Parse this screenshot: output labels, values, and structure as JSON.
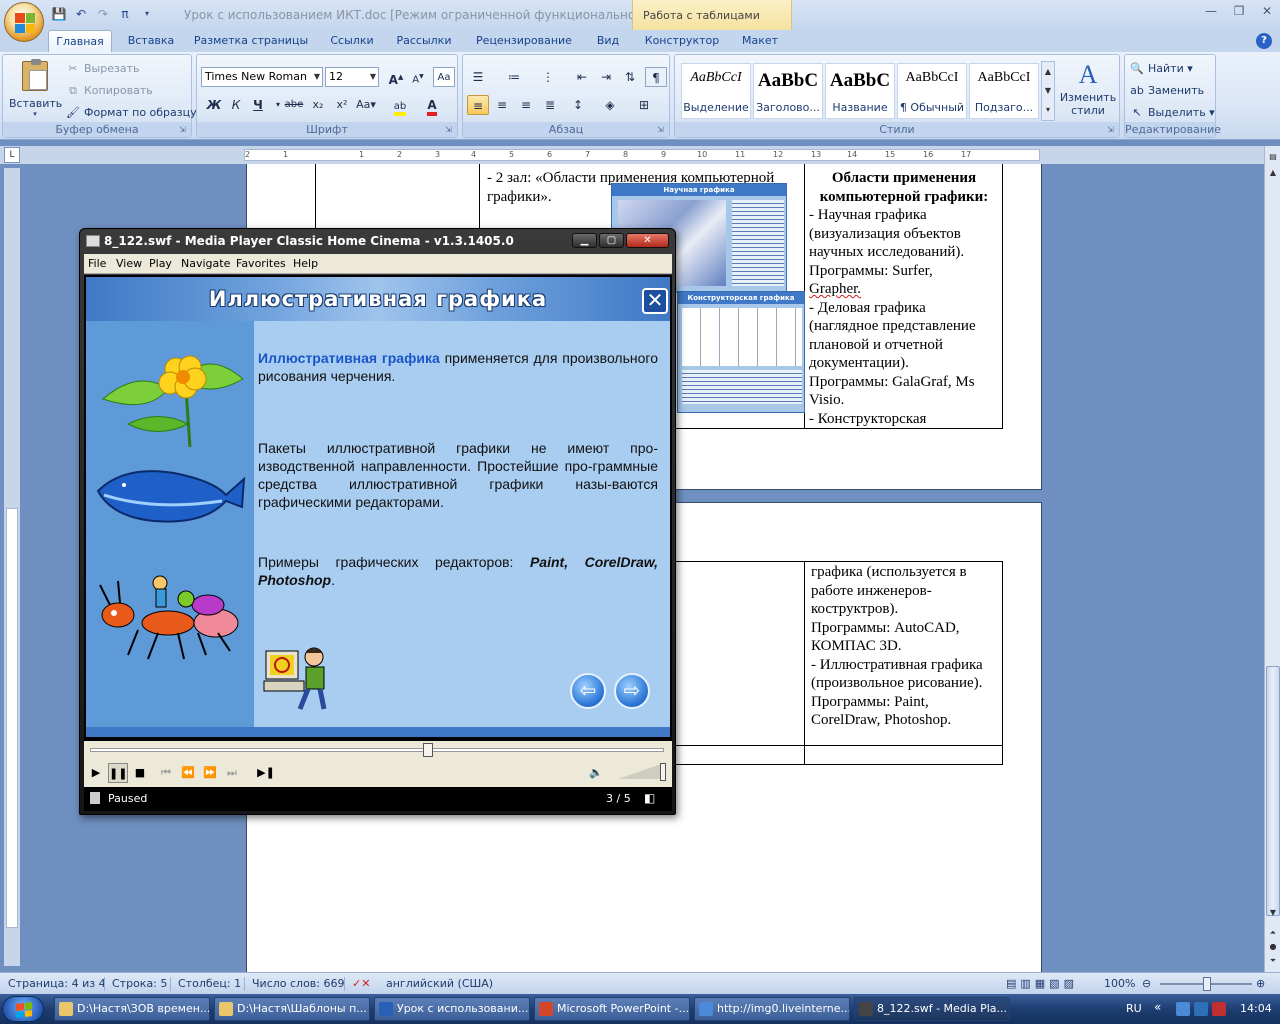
{
  "word": {
    "title": "Урок с использованием ИКТ.doc [Режим ограниченной функциональности] - M",
    "contextual_tab_group": "Работа с таблицами",
    "tabs": [
      "Главная",
      "Вставка",
      "Разметка страницы",
      "Ссылки",
      "Рассылки",
      "Рецензирование",
      "Вид",
      "Конструктор",
      "Макет"
    ],
    "active_tab": "Главная",
    "ribbon": {
      "clipboard": {
        "paste": "Вставить",
        "cut": "Вырезать",
        "copy": "Копировать",
        "format_painter": "Формат по образцу",
        "label": "Буфер обмена"
      },
      "font": {
        "name": "Times New Roman",
        "size": "12",
        "label": "Шрифт",
        "bold": "Ж",
        "italic": "К",
        "underline": "Ч",
        "strike": "abe",
        "sub": "x₂",
        "sup": "x²",
        "case": "Aa",
        "grow": "A",
        "shrink": "A"
      },
      "paragraph": {
        "label": "Абзац"
      },
      "styles": {
        "items": [
          {
            "sample": "AaBbCcI",
            "name": "Выделение"
          },
          {
            "sample": "AaBbC",
            "name": "Заголово..."
          },
          {
            "sample": "AaBbC",
            "name": "Название"
          },
          {
            "sample": "AaBbCcI",
            "name": "¶ Обычный"
          },
          {
            "sample": "AaBbCcI",
            "name": "Подзаго..."
          }
        ],
        "change": "Изменить стили",
        "label": "Стили"
      },
      "editing": {
        "find": "Найти",
        "replace": "Заменить",
        "select": "Выделить",
        "label": "Редактирование"
      }
    },
    "ruler": {
      "marks": [
        "2",
        "1",
        "1",
        "2",
        "3",
        "4",
        "5",
        "6",
        "7",
        "8",
        "9",
        "10",
        "11",
        "12",
        "13",
        "14",
        "15",
        "16",
        "17"
      ]
    },
    "document": {
      "page1_cell_mid": "- 2 зал: «Области применения компьютерной графики».",
      "page1_cell_right": {
        "heading": "Области применения компьютерной графики:",
        "lines": [
          "- Научная графика",
          "(визуализация объектов",
          "научных исследований).",
          "Программы: Surfer,",
          "Grapher.",
          "- Деловая графика",
          "(наглядное представление",
          "плановой и отчетной",
          "документации).",
          "Программы: GalaGraf, Ms",
          "Visio.",
          "- Конструкторская"
        ]
      },
      "page2_cell_right": [
        "графика (используется в",
        "работе инженеров-",
        "коструктров).",
        "Программы: AutoCAD,",
        "КОМПАС 3D.",
        "- Иллюстративная графика",
        "(произвольное рисование).",
        "Программы: Paint,",
        "CorelDraw, Photoshop."
      ],
      "thumb1_title": "Научная графика",
      "thumb2_title": "Конструкторская графика"
    },
    "status": {
      "page": "Страница: 4 из 4",
      "line": "Строка: 5",
      "column": "Столбец: 1",
      "words": "Число слов: 669",
      "language": "английский (США)",
      "zoom": "100%"
    }
  },
  "mpc": {
    "title": "8_122.swf - Media Player Classic Home Cinema - v1.3.1405.0",
    "menu": [
      "File",
      "View",
      "Play",
      "Navigate",
      "Favorites",
      "Help"
    ],
    "status": "Paused",
    "counter": "3 / 5",
    "seek_fraction": 0.59,
    "slide": {
      "title": "Иллюстративная графика",
      "p1_highlight": "Иллюстративная графика",
      "p1_rest": " применяется для произвольного рисования  черчения.",
      "p2": "Пакеты иллюстративной графики не имеют про-изводственной направленности. Простейшие про-граммные средства иллюстративной графики назы-ваются графическими редакторами.",
      "p3_lead": "Примеры графических редакторов: ",
      "p3_bold": "Paint, CorelDraw, Photoshop",
      "p3_end": "."
    }
  },
  "taskbar": {
    "tasks": [
      "D:\\Настя\\ЗОВ времен...",
      "D:\\Настя\\Шаблоны п...",
      "Урок с использовани...",
      "Microsoft PowerPoint -...",
      "http://img0.liveinterne...",
      "8_122.swf - Media Pla..."
    ],
    "lang": "RU",
    "clock": "14:04"
  }
}
